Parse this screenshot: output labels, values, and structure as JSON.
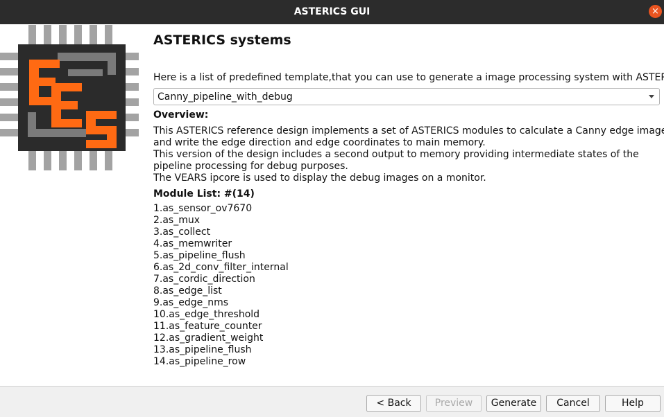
{
  "window": {
    "title": "ASTERICS GUI",
    "close_glyph": "×"
  },
  "logo": {
    "icon": "asterics-chip-logo-icon",
    "colors": {
      "orange": "#ff6a13",
      "dark": "#2b2b2b",
      "gray": "#7a7a7a",
      "pin": "#a3a3a3"
    }
  },
  "main": {
    "heading": "ASTERICS systems",
    "intro": "Here is a list of predefined template,that you can use to generate a image processing system with ASTERICS",
    "template_select": {
      "selected": "Canny_pipeline_with_debug"
    },
    "overview_label": "Overview:",
    "overview_lines": [
      "This ASTERICS reference design implements a set of ASTERICS modules to calculate a Canny edge image",
      "and write the edge direction and edge coordinates to main memory.",
      "This version of the design includes a second output to memory providing intermediate states of the",
      "pipeline processing for debug purposes.",
      "The VEARS ipcore is used to display the debug images on a monitor."
    ],
    "module_list_label": "Module List: #(14)",
    "modules": [
      "1.as_sensor_ov7670",
      "2.as_mux",
      "3.as_collect",
      "4.as_memwriter",
      "5.as_pipeline_flush",
      "6.as_2d_conv_filter_internal",
      "7.as_cordic_direction",
      "8.as_edge_list",
      "9.as_edge_nms",
      "10.as_edge_threshold",
      "11.as_feature_counter",
      "12.as_gradient_weight",
      "13.as_pipeline_flush",
      "14.as_pipeline_row"
    ]
  },
  "buttons": {
    "back": "< Back",
    "preview": "Preview",
    "generate": "Generate",
    "cancel": "Cancel",
    "help": "Help"
  },
  "colors": {
    "titlebar": "#2c2c2c",
    "close": "#e95420"
  }
}
